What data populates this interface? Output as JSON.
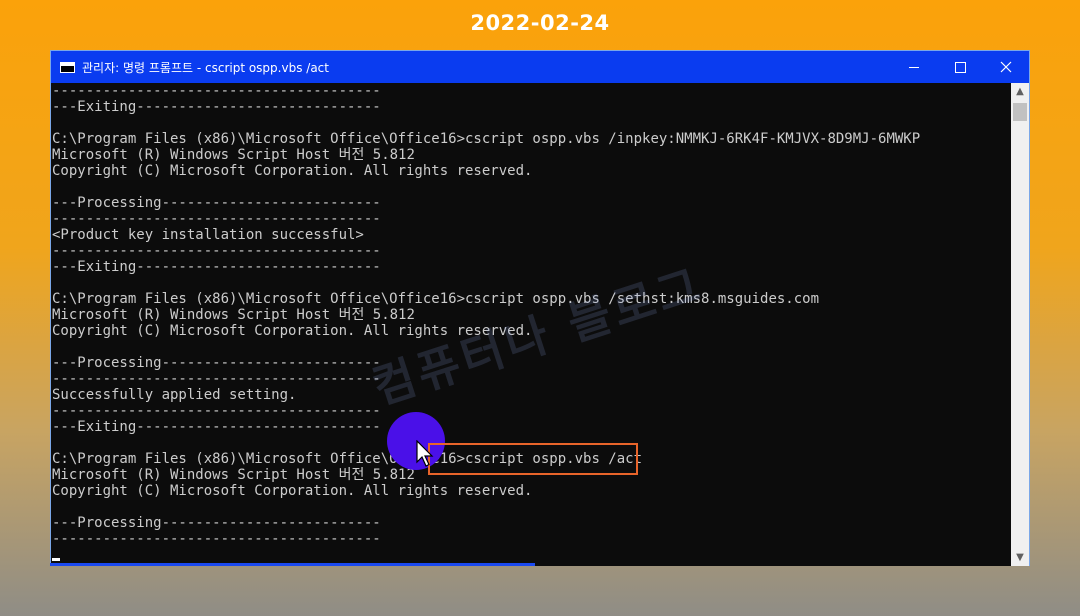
{
  "overlay": {
    "date": "2022-02-24"
  },
  "window": {
    "title": "관리자: 명령 프롬프트 - cscript  ospp.vbs /act",
    "icon": "cmd-icon",
    "controls": [
      "minimize-icon",
      "maximize-icon",
      "close-icon"
    ]
  },
  "console": {
    "lines": [
      "---------------------------------------",
      "---Exiting-----------------------------",
      "",
      "C:\\Program Files (x86)\\Microsoft Office\\Office16>cscript ospp.vbs /inpkey:NMMKJ-6RK4F-KMJVX-8D9MJ-6MWKP",
      "Microsoft (R) Windows Script Host 버전 5.812",
      "Copyright (C) Microsoft Corporation. All rights reserved.",
      "",
      "---Processing--------------------------",
      "---------------------------------------",
      "<Product key installation successful>",
      "---------------------------------------",
      "---Exiting-----------------------------",
      "",
      "C:\\Program Files (x86)\\Microsoft Office\\Office16>cscript ospp.vbs /sethst:kms8.msguides.com",
      "Microsoft (R) Windows Script Host 버전 5.812",
      "Copyright (C) Microsoft Corporation. All rights reserved.",
      "",
      "---Processing--------------------------",
      "---------------------------------------",
      "Successfully applied setting.",
      "---------------------------------------",
      "---Exiting-----------------------------",
      "",
      "C:\\Program Files (x86)\\Microsoft Office\\Office16>cscript ospp.vbs /act",
      "Microsoft (R) Windows Script Host 버전 5.812",
      "Copyright (C) Microsoft Corporation. All rights reserved.",
      "",
      "---Processing--------------------------",
      "---------------------------------------"
    ]
  },
  "watermark": {
    "text": "컴퓨터나 블로그"
  },
  "colors": {
    "titlebar": "#0a3cf0",
    "console_bg": "#0c0c0c",
    "console_fg": "#cccccc",
    "highlight": "#e8642a",
    "click_marker": "#4a10e8"
  }
}
